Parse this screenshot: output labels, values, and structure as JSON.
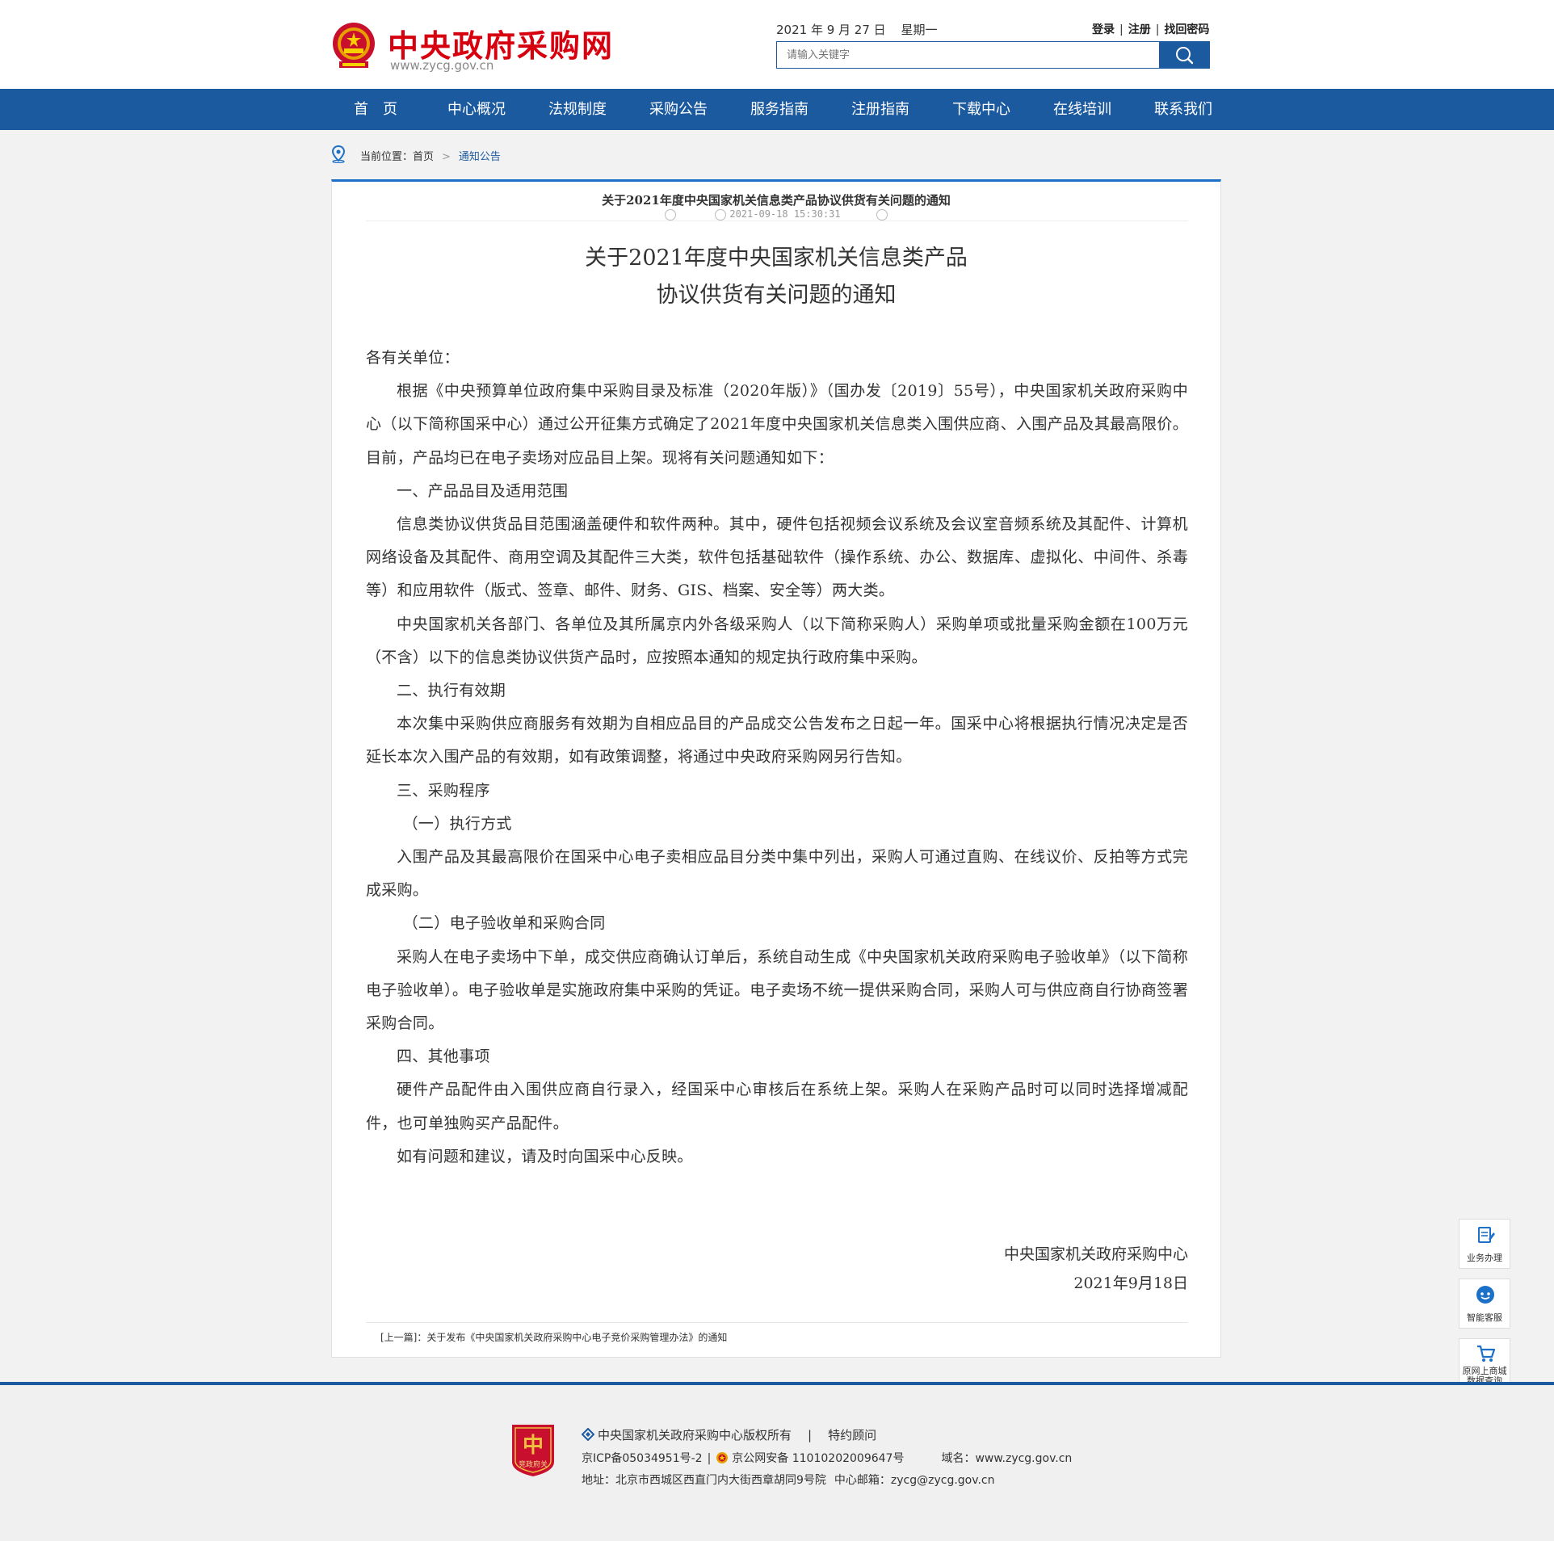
{
  "header": {
    "site_title": "中央政府采购网",
    "site_url": "www.zycg.gov.cn",
    "date": "2021 年 9 月 27 日",
    "weekday": "星期一",
    "login": "登录",
    "register": "注册",
    "recover_password": "找回密码",
    "search_placeholder": "请输入关键字"
  },
  "nav": {
    "items": [
      "首　页",
      "中心概况",
      "法规制度",
      "采购公告",
      "服务指南",
      "注册指南",
      "下载中心",
      "在线培训",
      "联系我们"
    ]
  },
  "breadcrumb": {
    "label": "当前位置：首页",
    "current": "通知公告"
  },
  "article": {
    "header_title": "关于2021年度中央国家机关信息类产品协议供货有关问题的通知",
    "datetime": "2021-09-18 15:30:31",
    "title_line1": "关于2021年度中央国家机关信息类产品",
    "title_line2": "协议供货有关问题的通知",
    "paragraphs": [
      "各有关单位：",
      "根据《中央预算单位政府集中采购目录及标准（2020年版）》（国办发〔2019〕55号），中央国家机关政府采购中心（以下简称国采中心）通过公开征集方式确定了2021年度中央国家机关信息类入围供应商、入围产品及其最高限价。目前，产品均已在电子卖场对应品目上架。现将有关问题通知如下：",
      "一、产品品目及适用范围",
      "信息类协议供货品目范围涵盖硬件和软件两种。其中，硬件包括视频会议系统及会议室音频系统及其配件、计算机网络设备及其配件、商用空调及其配件三大类，软件包括基础软件（操作系统、办公、数据库、虚拟化、中间件、杀毒等）和应用软件（版式、签章、邮件、财务、GIS、档案、安全等）两大类。",
      "中央国家机关各部门、各单位及其所属京内外各级采购人（以下简称采购人）采购单项或批量采购金额在100万元（不含）以下的信息类协议供货产品时，应按照本通知的规定执行政府集中采购。",
      "二、执行有效期",
      "本次集中采购供应商服务有效期为自相应品目的产品成交公告发布之日起一年。国采中心将根据执行情况决定是否延长本次入围产品的有效期，如有政策调整，将通过中央政府采购网另行告知。",
      "三、采购程序",
      "（一）执行方式",
      "入围产品及其最高限价在国采中心电子卖相应品目分类中集中列出，采购人可通过直购、在线议价、反拍等方式完成采购。",
      "（二）电子验收单和采购合同",
      "采购人在电子卖场中下单，成交供应商确认订单后，系统自动生成《中央国家机关政府采购电子验收单》（以下简称电子验收单）。电子验收单是实施政府集中采购的凭证。电子卖场不统一提供采购合同，采购人可与供应商自行协商签署采购合同。",
      "四、其他事项",
      "硬件产品配件由入围供应商自行录入，经国采中心审核后在系统上架。采购人在采购产品时可以同时选择增减配件，也可单独购买产品配件。",
      "如有问题和建议，请及时向国采中心反映。"
    ],
    "signature_org": "中央国家机关政府采购中心",
    "signature_date": "2021年9月18日",
    "prev_link": "[上一篇]：关于发布《中央国家机关政府采购中心电子竞价采购管理办法》的通知"
  },
  "side_buttons": {
    "business": "业务办理",
    "service": "智能客服",
    "mall_line1": "原网上商城",
    "mall_line2": "数据查询"
  },
  "footer": {
    "logo_text": "竞政府关",
    "copyright": "中央国家机关政府采购中心版权所有",
    "advisor": "特约顾问",
    "icp": "京ICP备05034951号-2",
    "police": "京公网安备 11010202009647号",
    "domain": "域名：www.zycg.gov.cn",
    "address": "地址：北京市西城区西直门内大街西章胡同9号院",
    "email": "中心邮箱：zycg@zycg.gov.cn"
  },
  "colors": {
    "brand_red": "#d7000f",
    "nav_blue": "#1c5a9f",
    "accent_blue": "#1c70c8"
  }
}
